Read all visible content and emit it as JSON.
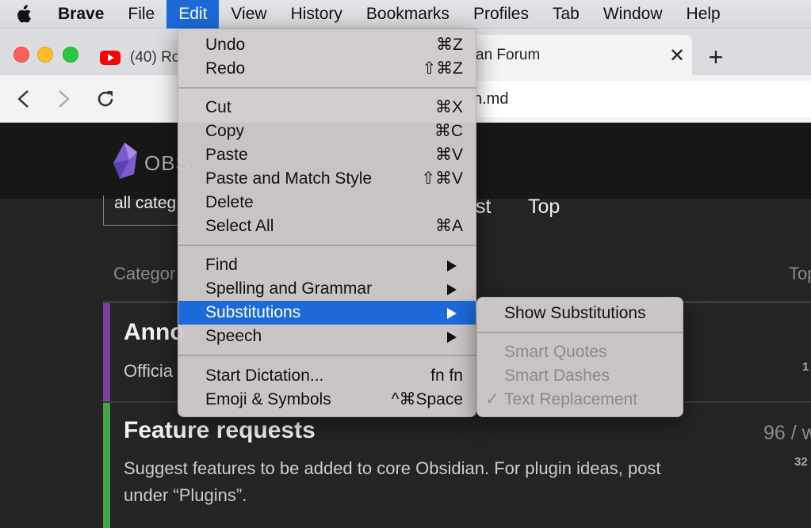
{
  "menubar": {
    "items": [
      "Brave",
      "File",
      "Edit",
      "View",
      "History",
      "Bookmarks",
      "Profiles",
      "Tab",
      "Window",
      "Help"
    ]
  },
  "browser": {
    "tab_left_title": "(40) Ro",
    "tab_active_title": "an Forum",
    "url_text": "n.md",
    "colors": {
      "close": "#fe5f57",
      "minimize": "#febc2e",
      "zoom": "#28c840",
      "youtube": "#ff0000"
    }
  },
  "page": {
    "logo_text": "OBS",
    "filter_select": "all categ",
    "nav_latest_partial": "st",
    "nav_top": "Top",
    "col_category": "Categor",
    "col_topics": "Top",
    "announcements": {
      "title": "Anno",
      "desc": "Officia",
      "count": "1",
      "color": "#7a3fa0"
    },
    "feature_requests": {
      "title": "Feature requests",
      "desc_line1": "Suggest features to be added to core Obsidian. For plugin ideas, post",
      "desc_line2": "under “Plugins”.",
      "count": "96 / w",
      "count2": "32",
      "color": "#3ca545"
    }
  },
  "edit_menu": {
    "undo": {
      "label": "Undo",
      "shortcut": "⌘Z"
    },
    "redo": {
      "label": "Redo",
      "shortcut": "⇧⌘Z"
    },
    "cut": {
      "label": "Cut",
      "shortcut": "⌘X"
    },
    "copy": {
      "label": "Copy",
      "shortcut": "⌘C"
    },
    "paste": {
      "label": "Paste",
      "shortcut": "⌘V"
    },
    "paste_match": {
      "label": "Paste and Match Style",
      "shortcut": "⇧⌘V"
    },
    "delete": {
      "label": "Delete"
    },
    "select_all": {
      "label": "Select All",
      "shortcut": "⌘A"
    },
    "find": {
      "label": "Find"
    },
    "spelling": {
      "label": "Spelling and Grammar"
    },
    "substitutions": {
      "label": "Substitutions"
    },
    "speech": {
      "label": "Speech"
    },
    "dictation": {
      "label": "Start Dictation...",
      "shortcut": "fn fn"
    },
    "emoji": {
      "label": "Emoji & Symbols",
      "shortcut": "^⌘Space"
    }
  },
  "substitutions_menu": {
    "show": "Show Substitutions",
    "smart_quotes": "Smart Quotes",
    "smart_dashes": "Smart Dashes",
    "text_replacement": "Text Replacement",
    "check": "✓"
  }
}
